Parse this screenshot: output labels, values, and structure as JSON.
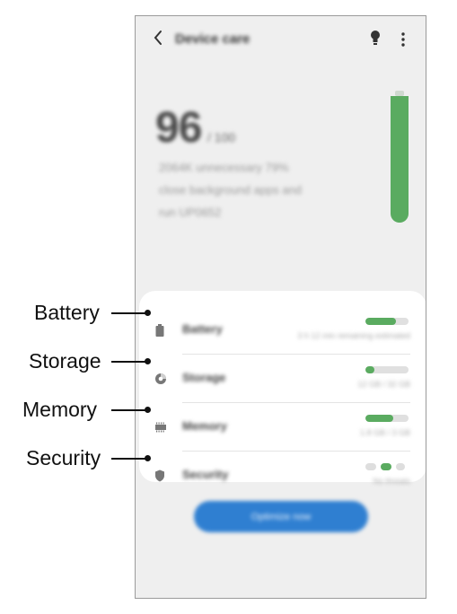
{
  "app_bar": {
    "title": "Device care",
    "back_icon": "chevron-left-icon",
    "tips_icon": "lightbulb-icon",
    "more_icon": "more-vertical-icon"
  },
  "score": {
    "value": "96",
    "unit": "/ 100",
    "description_lines": [
      "2064K unnecessary 79%",
      "close background apps and",
      "run UP0652"
    ],
    "gauge_level": 0.96
  },
  "items": [
    {
      "label": "Battery",
      "icon": "battery-icon",
      "level": 0.7,
      "sub": "3 h 12 min remaining estimated"
    },
    {
      "label": "Storage",
      "icon": "pie-chart-icon",
      "level": 0.2,
      "sub": "12 GB / 32 GB"
    },
    {
      "label": "Memory",
      "icon": "memory-chip-icon",
      "level": 0.65,
      "sub": "1.8 GB / 3 GB"
    },
    {
      "label": "Security",
      "icon": "shield-icon",
      "level": 0.5,
      "sub": "No threats"
    }
  ],
  "primary_button": {
    "label": "Optimize now"
  },
  "callouts": [
    "Battery",
    "Storage",
    "Memory",
    "Security"
  ],
  "colors": {
    "accent_green": "#5aab60",
    "button_blue": "#2f7fd1",
    "background": "#efefef"
  }
}
